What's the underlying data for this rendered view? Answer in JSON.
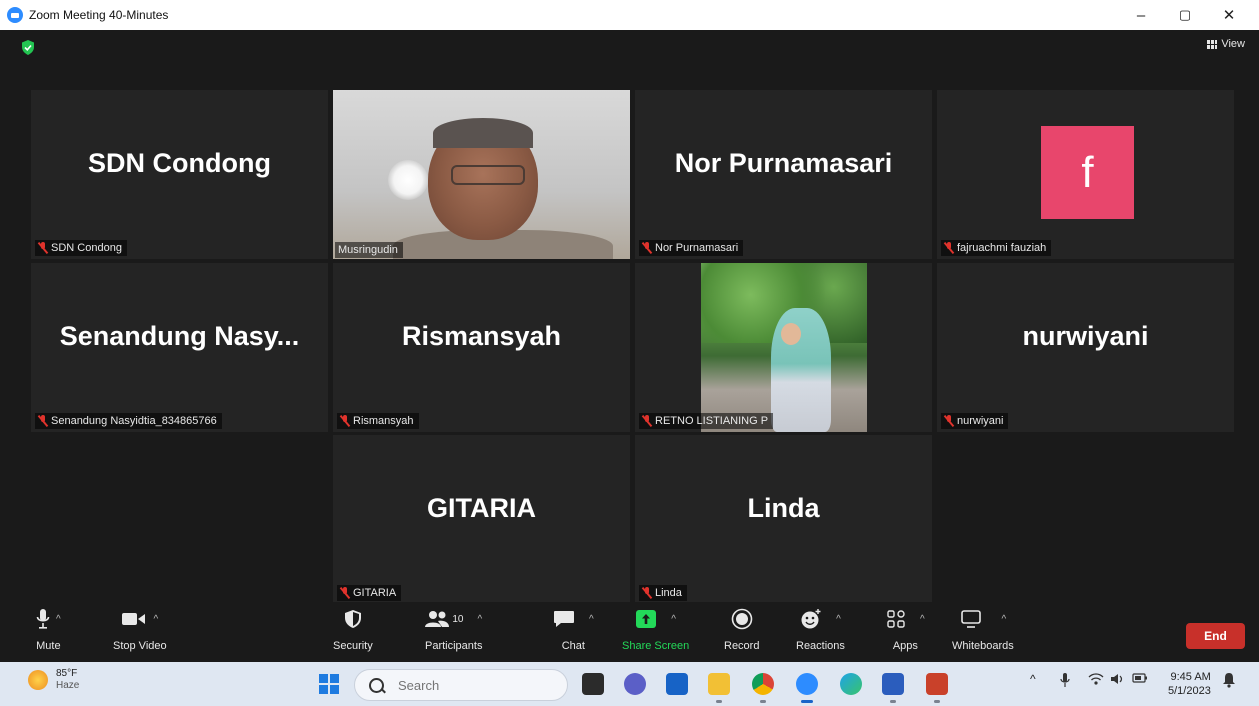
{
  "window": {
    "title": "Zoom Meeting 40-Minutes",
    "minimize": "–",
    "restore": "▢",
    "close": "✕"
  },
  "meeting": {
    "view_label": "View",
    "tiles": [
      {
        "display": "SDN Condong",
        "name": "SDN Condong",
        "kind": "name"
      },
      {
        "display": "",
        "name": "Musringudin",
        "kind": "video"
      },
      {
        "display": "Nor Purnamasari",
        "name": "Nor Purnamasari",
        "kind": "name"
      },
      {
        "display": "f",
        "name": "fajruachmi fauziah",
        "kind": "avatar"
      },
      {
        "display": "Senandung  Nasy...",
        "name": "Senandung Nasyidtia_834865766",
        "kind": "name"
      },
      {
        "display": "Rismansyah",
        "name": "Rismansyah",
        "kind": "name"
      },
      {
        "display": "",
        "name": "RETNO LISTIANING P",
        "kind": "photo"
      },
      {
        "display": "nurwiyani",
        "name": "nurwiyani",
        "kind": "name"
      },
      {
        "display": "GITARIA",
        "name": "GITARIA",
        "kind": "name"
      },
      {
        "display": "Linda",
        "name": "Linda",
        "kind": "name"
      }
    ]
  },
  "toolbar": {
    "mute": "Mute",
    "stop_video": "Stop Video",
    "security": "Security",
    "participants": "Participants",
    "participants_count": "10",
    "chat": "Chat",
    "share_screen": "Share Screen",
    "record": "Record",
    "reactions": "Reactions",
    "apps": "Apps",
    "whiteboards": "Whiteboards",
    "end": "End",
    "share_color": "#23d959",
    "end_color": "#c8302a"
  },
  "taskbar": {
    "temperature": "85°F",
    "condition": "Haze",
    "search_placeholder": "Search",
    "time": "9:45 AM",
    "date": "5/1/2023"
  }
}
